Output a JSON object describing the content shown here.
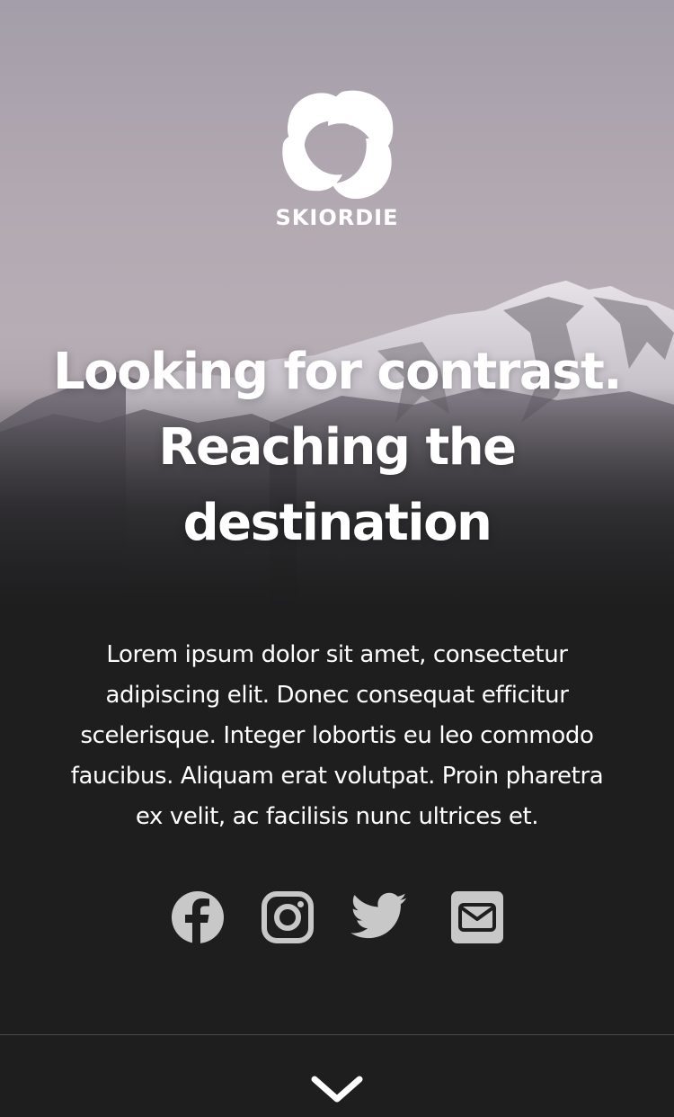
{
  "brand": {
    "logo_text": "SKIORDIE"
  },
  "hero": {
    "headline_lines": [
      "Looking for contrast.",
      "Reaching the",
      "destination"
    ]
  },
  "intro": {
    "text_lines": [
      "Lorem ipsum dolor sit amet, consectetur",
      "adipiscing elit. Donec consequat efficitur",
      "scelerisque. Integer lobortis eu leo commodo",
      "faucibus. Aliquam erat volutpat. Proin pharetra",
      "ex velit, ac facilisis nunc ultrices et."
    ]
  },
  "social_links": [
    {
      "icon": "facebook-icon"
    },
    {
      "icon": "instagram-icon"
    },
    {
      "icon": "twitter-icon"
    },
    {
      "icon": "email-icon"
    }
  ],
  "scroll": {
    "icon": "chevron-down-icon"
  },
  "colors": {
    "background": "#1e1e1f",
    "sky_top": "#a9a2ad",
    "text": "#ffffff",
    "icon": "#c8c8c8",
    "divider": "#4a4a4c"
  }
}
